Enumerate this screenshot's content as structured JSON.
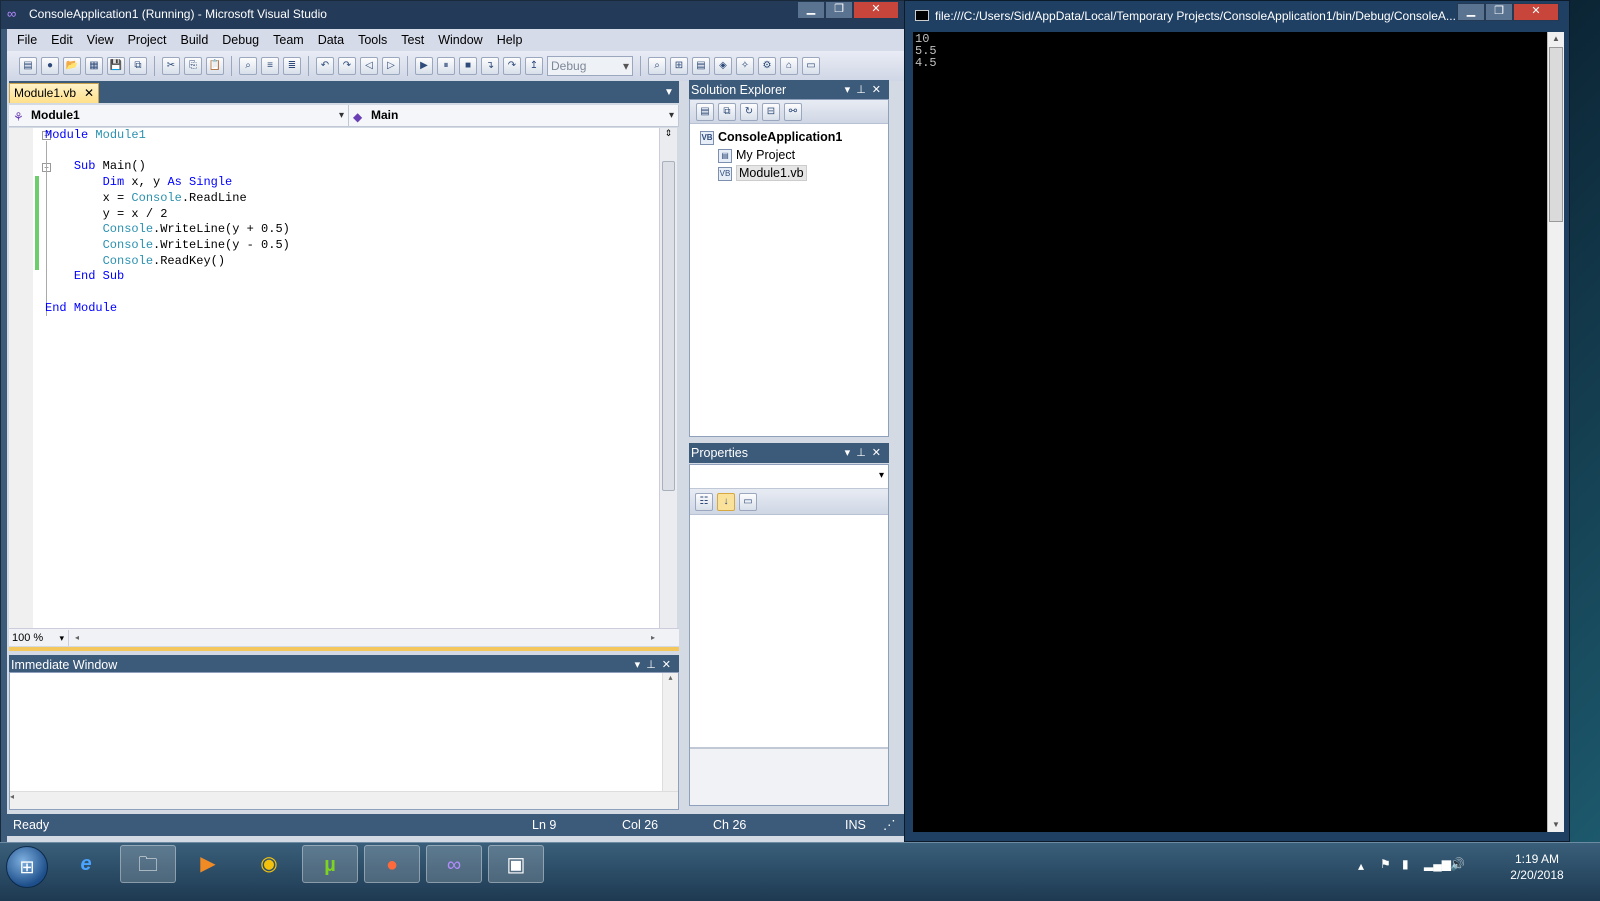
{
  "vs": {
    "title": "ConsoleApplication1 (Running) - Microsoft Visual Studio",
    "menu": [
      "File",
      "Edit",
      "View",
      "Project",
      "Build",
      "Debug",
      "Team",
      "Data",
      "Tools",
      "Test",
      "Window",
      "Help"
    ],
    "config": "Debug",
    "doc_tab": "Module1.vb",
    "nav_left": "Module1",
    "nav_right": "Main",
    "zoom": "100 %",
    "immediate_title": "Immediate Window",
    "solution_explorer_title": "Solution Explorer",
    "properties_title": "Properties",
    "solution": {
      "name": "ConsoleApplication1",
      "items": [
        "My Project",
        "Module1.vb"
      ]
    },
    "status": {
      "state": "Ready",
      "ln": "Ln 9",
      "col": "Col 26",
      "ch": "Ch 26",
      "mode": "INS"
    }
  },
  "code_lines": [
    "Module Module1",
    "",
    "    Sub Main()",
    "        Dim x, y As Single",
    "        x = Console.ReadLine",
    "        y = x / 2",
    "        Console.WriteLine(y + 0.5)",
    "        Console.WriteLine(y - 0.5)",
    "        Console.ReadKey()",
    "    End Sub",
    "",
    "End Module"
  ],
  "console": {
    "title": "file:///C:/Users/Sid/AppData/Local/Temporary Projects/ConsoleApplication1/bin/Debug/ConsoleA...",
    "output": [
      "10",
      "5.5",
      "4.5"
    ]
  },
  "taskbar": {
    "apps": [
      "internet-explorer",
      "file-explorer",
      "media-player",
      "chrome",
      "utorrent",
      "unknown-app",
      "visual-studio",
      "console-window"
    ],
    "time": "1:19 AM",
    "date": "2/20/2018"
  },
  "colors": {
    "keyword": "#0000ff",
    "type": "#2b91af",
    "title_bar": "#233a58",
    "tab_active": "#ffe08a"
  }
}
